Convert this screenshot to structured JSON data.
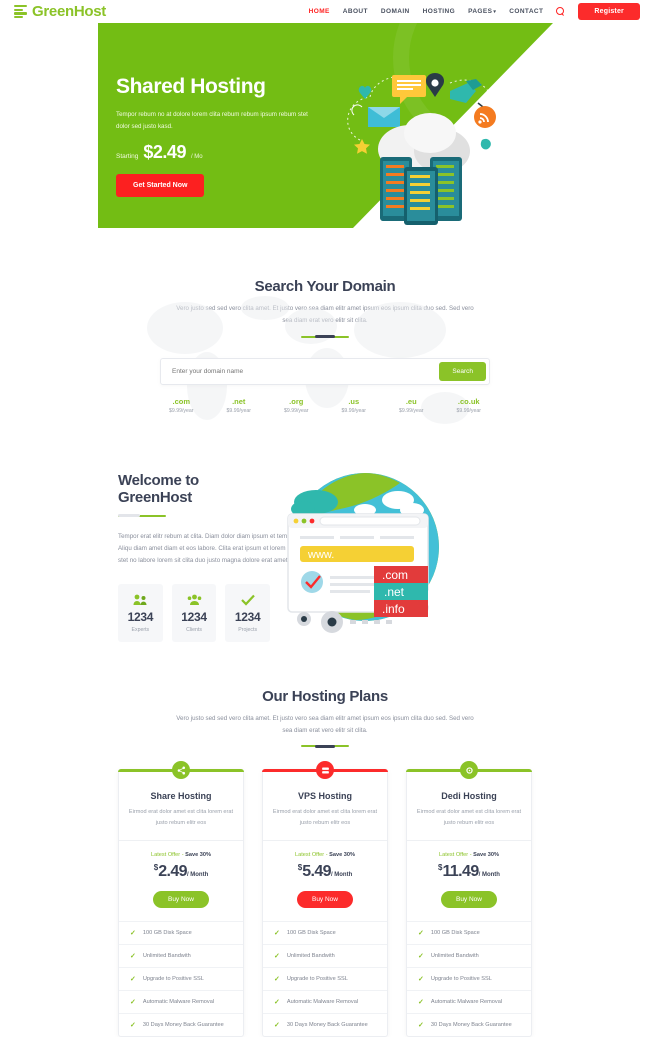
{
  "colors": {
    "green": "#8bc328",
    "hero_green": "#73bd14",
    "red": "#fc2b2b",
    "dark": "#3b4256"
  },
  "header": {
    "logo_text": "GreenHost",
    "logo_icon": "server-stack-icon",
    "nav": [
      {
        "label": "HOME",
        "active": true
      },
      {
        "label": "ABOUT",
        "active": false
      },
      {
        "label": "DOMAIN",
        "active": false
      },
      {
        "label": "HOSTING",
        "active": false
      },
      {
        "label": "PAGES",
        "active": false,
        "caret": "▾"
      },
      {
        "label": "CONTACT",
        "active": false
      }
    ],
    "search_icon": "search-icon",
    "register_label": "Register"
  },
  "hero": {
    "title": "Shared Hosting",
    "description": "Tempor rebum no at dolore lorem clita rebum rebum ipsum rebum stet dolor sed justo kasd.",
    "starting_label": "Starting",
    "price": "$2.49",
    "per": "/ Mo",
    "button_label": "Get Started Now"
  },
  "domain": {
    "title": "Search Your Domain",
    "subtitle": "Vero justo sed sed vero clita amet. Et justo vero sea diam elitr amet ipsum eos ipsum clita duo sed. Sed vero sea diam erat vero elitr sit clita.",
    "placeholder": "Enter your domain name",
    "input_value": "",
    "search_label": "Search",
    "tlds": [
      {
        "name": ".com",
        "price": "$9.99/year"
      },
      {
        "name": ".net",
        "price": "$9.99/year"
      },
      {
        "name": ".org",
        "price": "$9.99/year"
      },
      {
        "name": ".us",
        "price": "$9.99/year"
      },
      {
        "name": ".eu",
        "price": "$9.99/year"
      },
      {
        "name": ".co.uk",
        "price": "$9.99/year"
      }
    ]
  },
  "welcome": {
    "title": "Welcome to GreenHost",
    "description": "Tempor erat elitr rebum at clita. Diam dolor diam ipsum et tempor sit. Aliqu diam amet diam et eos labore. Clita erat ipsum et lorem et sit, sed stet no labore lorem sit clita duo justo magna dolore erat amet",
    "stats": [
      {
        "icon": "experts-icon",
        "number": "1234",
        "label": "Experts"
      },
      {
        "icon": "clients-icon",
        "number": "1234",
        "label": "Clients"
      },
      {
        "icon": "projects-check-icon",
        "number": "1234",
        "label": "Projects"
      }
    ],
    "art": {
      "url_text": "www.",
      "tags": [
        ".com",
        ".net",
        ".info"
      ]
    }
  },
  "plans": {
    "title": "Our Hosting Plans",
    "subtitle": "Vero justo sed sed vero clita amet. Et justo vero sea diam elitr amet ipsum eos ipsum clita duo sed. Sed vero sea diam erat vero elitr sit clita.",
    "items": [
      {
        "badge_icon": "share-icon",
        "accent": "#8bc328",
        "name": "Share Hosting",
        "description": "Eirmod erat dolor amet est clita lorem erat justo rebum elitr eos",
        "offer_prefix": "Latest Offer - ",
        "offer_bold": "Save 30%",
        "currency": "$",
        "amount": "2.49",
        "period": "/ Month",
        "buy_label": "Buy Now",
        "features": [
          "100 GB Disk Space",
          "Unlimited Bandwith",
          "Upgrade to Positive SSL",
          "Automatic Malware Removal",
          "30 Days Money Back Guarantee"
        ]
      },
      {
        "badge_icon": "server-icon",
        "accent": "#fc2b2b",
        "name": "VPS Hosting",
        "description": "Eirmod erat dolor amet est clita lorem erat justo rebum elitr eos",
        "offer_prefix": "Latest Offer - ",
        "offer_bold": "Save 30%",
        "currency": "$",
        "amount": "5.49",
        "period": "/ Month",
        "buy_label": "Buy Now",
        "features": [
          "100 GB Disk Space",
          "Unlimited Bandwith",
          "Upgrade to Positive SSL",
          "Automatic Malware Removal",
          "30 Days Money Back Guarantee"
        ]
      },
      {
        "badge_icon": "settings-icon",
        "accent": "#8bc328",
        "name": "Dedi Hosting",
        "description": "Eirmod erat dolor amet est clita lorem erat justo rebum elitr eos",
        "offer_prefix": "Latest Offer - ",
        "offer_bold": "Save 30%",
        "currency": "$",
        "amount": "11.49",
        "period": "/ Month",
        "buy_label": "Buy Now",
        "features": [
          "100 GB Disk Space",
          "Unlimited Bandwith",
          "Upgrade to Positive SSL",
          "Automatic Malware Removal",
          "30 Days Money Back Guarantee"
        ]
      }
    ]
  }
}
